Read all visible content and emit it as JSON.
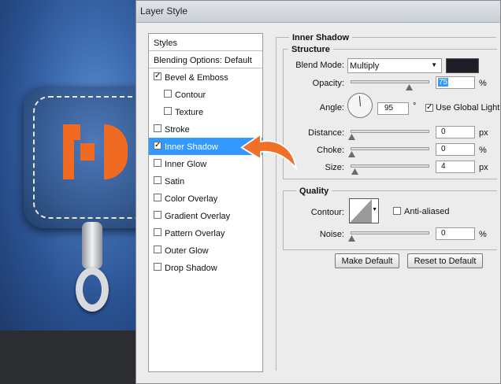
{
  "dialog": {
    "title": "Layer Style"
  },
  "styles_panel": {
    "header": "Styles",
    "blending_options": "Blending Options: Default",
    "items": [
      {
        "label": "Bevel & Emboss",
        "checked": true,
        "sub": false,
        "selected": false
      },
      {
        "label": "Contour",
        "checked": false,
        "sub": true,
        "selected": false
      },
      {
        "label": "Texture",
        "checked": false,
        "sub": true,
        "selected": false
      },
      {
        "label": "Stroke",
        "checked": false,
        "sub": false,
        "selected": false
      },
      {
        "label": "Inner Shadow",
        "checked": true,
        "sub": false,
        "selected": true
      },
      {
        "label": "Inner Glow",
        "checked": false,
        "sub": false,
        "selected": false
      },
      {
        "label": "Satin",
        "checked": false,
        "sub": false,
        "selected": false
      },
      {
        "label": "Color Overlay",
        "checked": false,
        "sub": false,
        "selected": false
      },
      {
        "label": "Gradient Overlay",
        "checked": false,
        "sub": false,
        "selected": false
      },
      {
        "label": "Pattern Overlay",
        "checked": false,
        "sub": false,
        "selected": false
      },
      {
        "label": "Outer Glow",
        "checked": false,
        "sub": false,
        "selected": false
      },
      {
        "label": "Drop Shadow",
        "checked": false,
        "sub": false,
        "selected": false
      }
    ]
  },
  "inner_shadow": {
    "title": "Inner Shadow",
    "structure_label": "Structure",
    "blend_mode_label": "Blend Mode:",
    "blend_mode_value": "Multiply",
    "shadow_color": "#1d1e26",
    "opacity_label": "Opacity:",
    "opacity_value": "75",
    "opacity_unit": "%",
    "angle_label": "Angle:",
    "angle_value": "95",
    "angle_unit": "°",
    "use_global_light_label": "Use Global Light",
    "use_global_light_checked": true,
    "distance_label": "Distance:",
    "distance_value": "0",
    "distance_unit": "px",
    "choke_label": "Choke:",
    "choke_value": "0",
    "choke_unit": "%",
    "size_label": "Size:",
    "size_value": "4",
    "size_unit": "px",
    "quality_label": "Quality",
    "contour_label": "Contour:",
    "anti_aliased_label": "Anti-aliased",
    "anti_aliased_checked": false,
    "noise_label": "Noise:",
    "noise_value": "0",
    "noise_unit": "%",
    "make_default_label": "Make Default",
    "reset_default_label": "Reset to Default"
  },
  "colors": {
    "selection": "#3399ff",
    "arrow": "#f07028",
    "letter": "#f06a21"
  }
}
